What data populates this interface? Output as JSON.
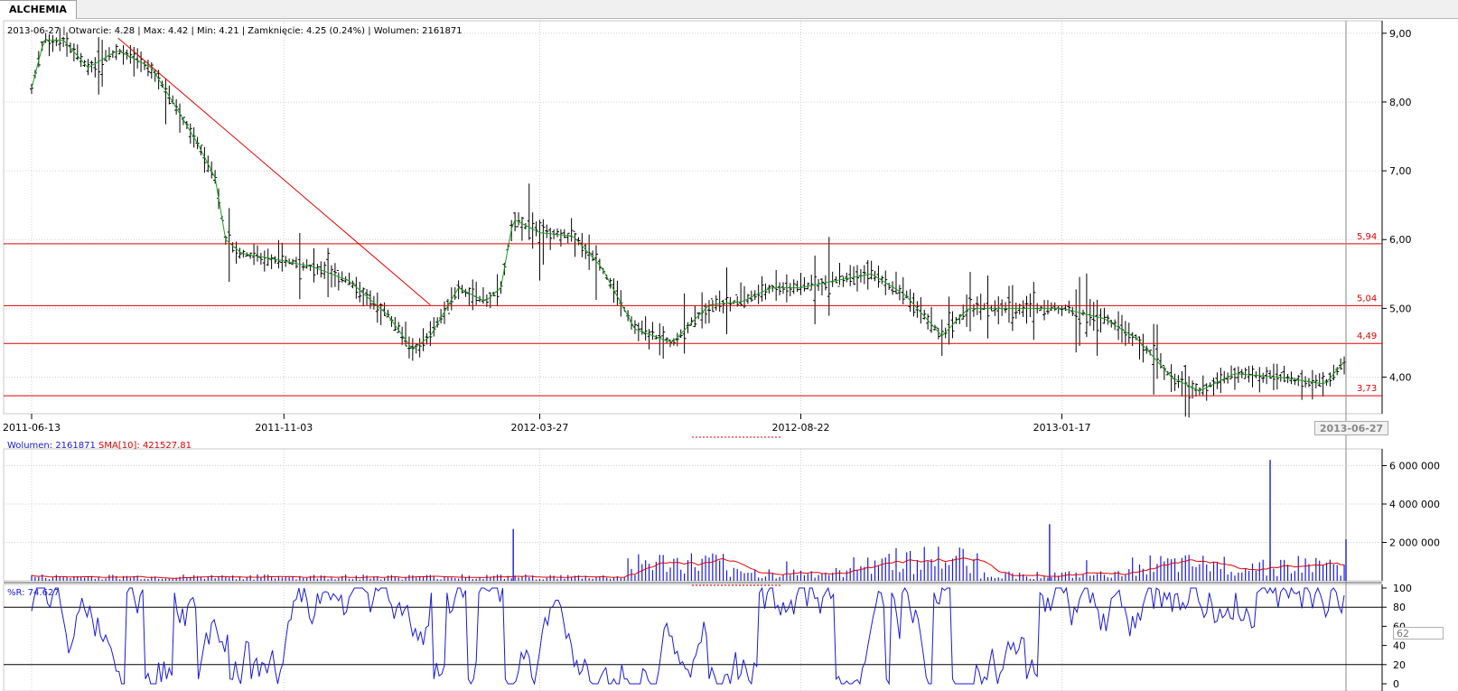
{
  "window": {
    "tab_title": "ALCHEMIA"
  },
  "header": {
    "date": "2013-06-27",
    "open": "4.28",
    "max": "4.42",
    "min": "4.21",
    "close": "4.25 (0.24%)",
    "volume": "2161871",
    "text": "2013-06-27 | Otwarcie: 4.28 | Max: 4.42 | Min: 4.21 | Zamknięcie: 4.25 (0.24%)  | Wolumen: 2161871"
  },
  "volume_header": {
    "volume_label": "Wolumen: 2161871",
    "sma_label": "SMA[10]: 421527.81"
  },
  "wr_header": {
    "label": "%R: 74.627",
    "value_box": "62"
  },
  "cursor_date": "2013-06-27",
  "colors": {
    "candle": "#000000",
    "ma_line": "#1aa01a",
    "support_line": "#e00000",
    "volume_bar": "#1a1ad8",
    "volume_sma": "#e00000",
    "wr_line": "#1a1ad8",
    "grid": "#d0d0d0"
  },
  "chart_data": [
    {
      "type": "candlestick",
      "title": "ALCHEMIA",
      "x_tick_labels": [
        "2011-06-13",
        "2011-11-03",
        "2012-03-27",
        "2012-08-22",
        "2013-01-17"
      ],
      "x_range": [
        "2011-06-13",
        "2013-06-27"
      ],
      "y_ticks": [
        "9,00",
        "8,00",
        "7,00",
        "6,00",
        "5,00",
        "4,00"
      ],
      "ylim": [
        3.6,
        9.05
      ],
      "horizontal_levels": [
        {
          "label": "5,94",
          "value": 5.94
        },
        {
          "label": "5,04",
          "value": 5.04
        },
        {
          "label": "4,49",
          "value": 4.49
        },
        {
          "label": "3,73",
          "value": 3.73
        }
      ],
      "trendline": {
        "from": {
          "date": "2011-08-01",
          "value": 8.93
        },
        "to": {
          "date": "2012-01-25",
          "value": 5.05
        }
      },
      "price_points": [
        {
          "date": "2011-06-13",
          "close": 8.2
        },
        {
          "date": "2011-06-20",
          "close": 8.9
        },
        {
          "date": "2011-07-01",
          "close": 8.9
        },
        {
          "date": "2011-07-15",
          "close": 8.5
        },
        {
          "date": "2011-08-01",
          "close": 8.75
        },
        {
          "date": "2011-08-20",
          "close": 8.5
        },
        {
          "date": "2011-09-01",
          "close": 8.0
        },
        {
          "date": "2011-09-15",
          "close": 7.4
        },
        {
          "date": "2011-09-25",
          "close": 6.9
        },
        {
          "date": "2011-10-01",
          "close": 6.0
        },
        {
          "date": "2011-10-10",
          "close": 5.8
        },
        {
          "date": "2011-11-01",
          "close": 5.7
        },
        {
          "date": "2011-11-20",
          "close": 5.6
        },
        {
          "date": "2011-12-10",
          "close": 5.4
        },
        {
          "date": "2012-01-01",
          "close": 4.9
        },
        {
          "date": "2012-01-15",
          "close": 4.4
        },
        {
          "date": "2012-01-25",
          "close": 4.6
        },
        {
          "date": "2012-02-10",
          "close": 5.3
        },
        {
          "date": "2012-02-25",
          "close": 5.1
        },
        {
          "date": "2012-03-05",
          "close": 5.3
        },
        {
          "date": "2012-03-12",
          "close": 6.3
        },
        {
          "date": "2012-03-27",
          "close": 6.1
        },
        {
          "date": "2012-04-15",
          "close": 6.05
        },
        {
          "date": "2012-05-01",
          "close": 5.6
        },
        {
          "date": "2012-05-20",
          "close": 4.7
        },
        {
          "date": "2012-06-10",
          "close": 4.5
        },
        {
          "date": "2012-07-01",
          "close": 5.05
        },
        {
          "date": "2012-07-20",
          "close": 5.1
        },
        {
          "date": "2012-08-05",
          "close": 5.3
        },
        {
          "date": "2012-08-22",
          "close": 5.3
        },
        {
          "date": "2012-09-10",
          "close": 5.4
        },
        {
          "date": "2012-10-01",
          "close": 5.5
        },
        {
          "date": "2012-10-20",
          "close": 5.2
        },
        {
          "date": "2012-11-10",
          "close": 4.6
        },
        {
          "date": "2012-11-25",
          "close": 5.0
        },
        {
          "date": "2012-12-20",
          "close": 5.0
        },
        {
          "date": "2013-01-17",
          "close": 5.0
        },
        {
          "date": "2013-02-10",
          "close": 4.85
        },
        {
          "date": "2013-03-01",
          "close": 4.55
        },
        {
          "date": "2013-03-20",
          "close": 4.0
        },
        {
          "date": "2013-04-05",
          "close": 3.8
        },
        {
          "date": "2013-04-25",
          "close": 4.05
        },
        {
          "date": "2013-05-20",
          "close": 4.0
        },
        {
          "date": "2013-06-15",
          "close": 3.9
        },
        {
          "date": "2013-06-27",
          "close": 4.25
        }
      ],
      "legend": "none"
    },
    {
      "type": "bar",
      "title": "Wolumen",
      "y_ticks": [
        "6 000 000",
        "4 000 000",
        "2 000 000"
      ],
      "ylim": [
        0,
        6400000
      ],
      "notable_spikes": [
        {
          "date": "2012-03-12",
          "value": 2700000
        },
        {
          "date": "2013-01-10",
          "value": 2950000
        },
        {
          "date": "2013-05-15",
          "value": 6300000
        },
        {
          "date": "2013-06-27",
          "value": 2161871
        }
      ],
      "typical_volume": [
        {
          "from": "2011-06-13",
          "to": "2012-05-15",
          "value": 200000
        },
        {
          "from": "2012-05-15",
          "to": "2012-07-10",
          "value": 900000
        },
        {
          "from": "2012-07-10",
          "to": "2012-09-20",
          "value": 400000
        },
        {
          "from": "2012-09-20",
          "to": "2012-11-30",
          "value": 1100000
        },
        {
          "from": "2012-11-30",
          "to": "2013-02-20",
          "value": 300000
        },
        {
          "from": "2013-02-20",
          "to": "2013-06-27",
          "value": 800000
        }
      ],
      "series": [
        {
          "name": "SMA[10]",
          "value_last": 421527.81
        }
      ]
    },
    {
      "type": "line",
      "title": "%R",
      "y_ticks": [
        "100",
        "80",
        "60",
        "40",
        "20",
        "0"
      ],
      "ylim": [
        0,
        100
      ],
      "levels": [
        80,
        20
      ],
      "last_value": 74.627
    }
  ]
}
